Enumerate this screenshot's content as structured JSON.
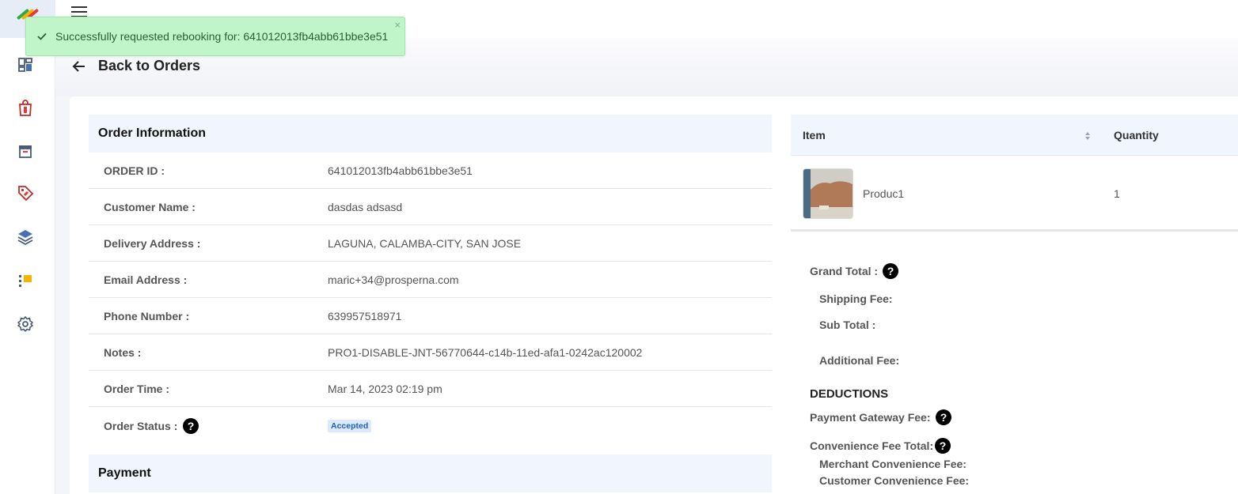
{
  "toast": {
    "message": "Successfully requested rebooking for: 641012013fb4abb61bbe3e51",
    "close": "×"
  },
  "header": {
    "back_label": "Back to Orders"
  },
  "sidebar": {
    "items": [
      {
        "icon": "dashboard-icon"
      },
      {
        "icon": "shopping-bag-icon"
      },
      {
        "icon": "archive-icon"
      },
      {
        "icon": "tag-icon"
      },
      {
        "icon": "layers-icon"
      },
      {
        "icon": "list-icon"
      },
      {
        "icon": "gear-icon"
      }
    ]
  },
  "order_info": {
    "title": "Order Information",
    "rows": [
      {
        "label": "ORDER ID :",
        "value": "641012013fb4abb61bbe3e51"
      },
      {
        "label": "Customer Name :",
        "value": "dasdas adsasd"
      },
      {
        "label": "Delivery Address :",
        "value": "LAGUNA, CALAMBA-CITY, SAN JOSE"
      },
      {
        "label": "Email Address :",
        "value": "maric+34@prosperna.com"
      },
      {
        "label": "Phone Number :",
        "value": "639957518971"
      },
      {
        "label": "Notes :",
        "value": "PRO1-DISABLE-JNT-56770644-c14b-11ed-afa1-0242ac120002"
      },
      {
        "label": "Order Time :",
        "value": "Mar 14, 2023 02:19 pm"
      },
      {
        "label": "Order Status :",
        "value": "Accepted"
      }
    ],
    "help": "?"
  },
  "payment": {
    "title": "Payment"
  },
  "items_table": {
    "columns": [
      "Item",
      "Quantity"
    ],
    "rows": [
      {
        "name": "Produc1",
        "quantity": "1"
      }
    ]
  },
  "summary": {
    "grand_total": "Grand Total :",
    "shipping_fee": "Shipping Fee:",
    "sub_total": "Sub Total :",
    "additional_fee": "Additional Fee:",
    "deductions": "DEDUCTIONS",
    "payment_gateway_fee": "Payment Gateway Fee:",
    "convenience_fee_total": "Convenience Fee Total:",
    "merchant_convenience_fee": "Merchant Convenience Fee:",
    "customer_convenience_fee": "Customer Convenience Fee:"
  },
  "colors": {
    "toast_bg": "#c0f5c9",
    "section_bg": "#f0f5fe",
    "badge_bg": "#dce9fb",
    "badge_text": "#1f5fbf"
  }
}
